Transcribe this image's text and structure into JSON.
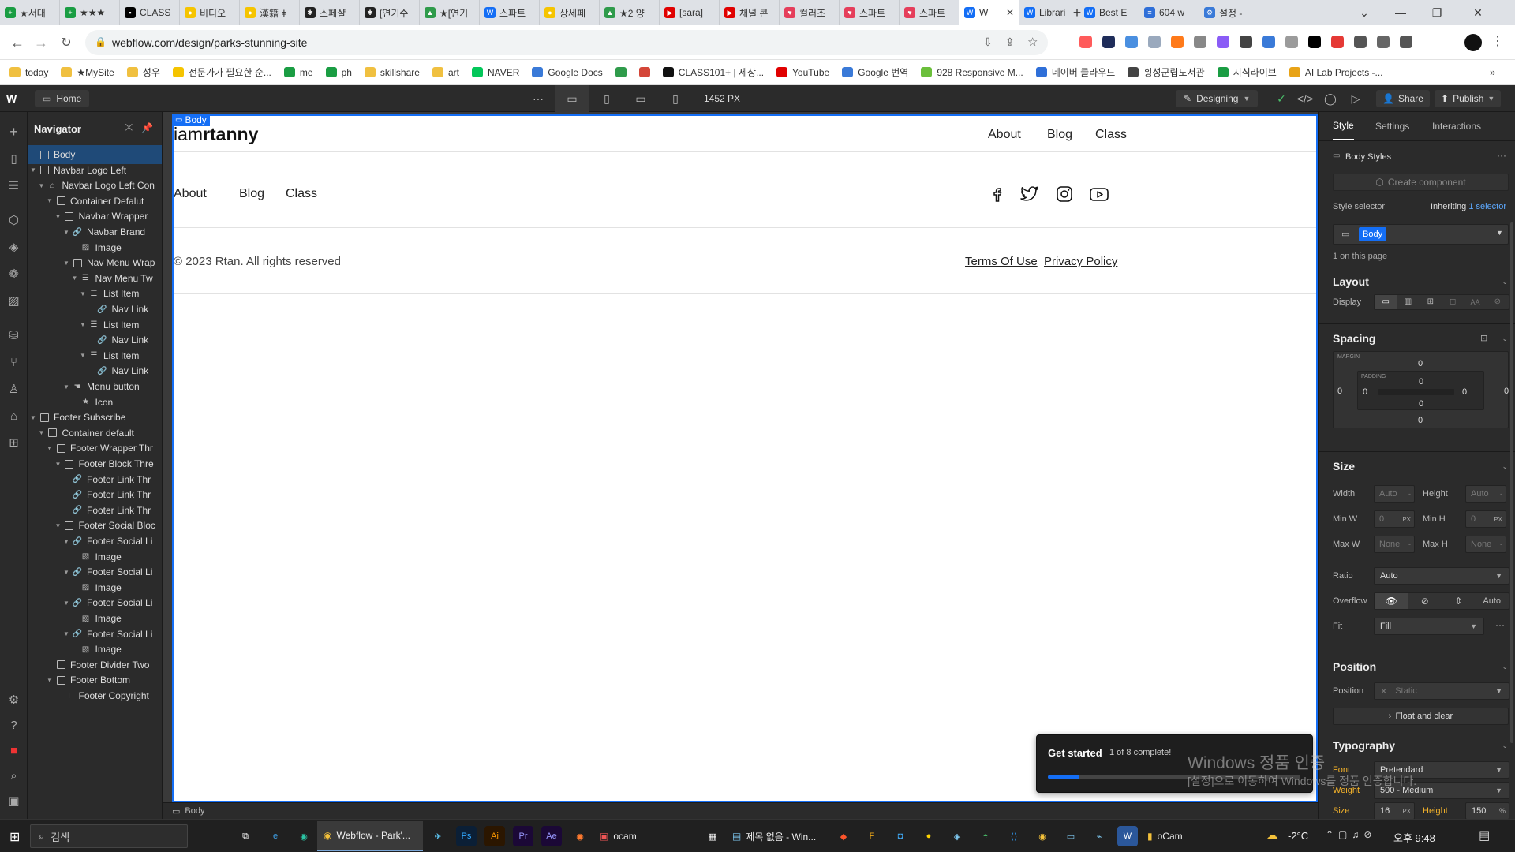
{
  "browser": {
    "tabs": [
      {
        "label": "★서대",
        "fav": "#1a9d43",
        "glyph": "+"
      },
      {
        "label": "★★★",
        "fav": "#1a9d43",
        "glyph": "+"
      },
      {
        "label": "CLASS",
        "fav": "#000000",
        "glyph": "▪"
      },
      {
        "label": "비디오",
        "fav": "#f5c400",
        "glyph": "●"
      },
      {
        "label": "漢籍 ǂ",
        "fav": "#f5c400",
        "glyph": "●"
      },
      {
        "label": "스페샬",
        "fav": "#222222",
        "glyph": "✱"
      },
      {
        "label": "[연기수",
        "fav": "#222222",
        "glyph": "✱"
      },
      {
        "label": "★[연기",
        "fav": "#2f9b4b",
        "glyph": "▲"
      },
      {
        "label": "스파트",
        "fav": "#146ef5",
        "glyph": "W"
      },
      {
        "label": "상세페",
        "fav": "#f5c400",
        "glyph": "●"
      },
      {
        "label": "★2 양",
        "fav": "#2f9b4b",
        "glyph": "▲"
      },
      {
        "label": "[sara]",
        "fav": "#e00000",
        "glyph": "▶"
      },
      {
        "label": "채널 콘",
        "fav": "#e00000",
        "glyph": "▶"
      },
      {
        "label": "컬러조",
        "fav": "#e53e5b",
        "glyph": "♥"
      },
      {
        "label": "스파트",
        "fav": "#e53e5b",
        "glyph": "♥"
      },
      {
        "label": "스파트",
        "fav": "#e53e5b",
        "glyph": "♥"
      },
      {
        "label": "W",
        "fav": "#146ef5",
        "glyph": "W",
        "active": true
      },
      {
        "label": "Librari",
        "fav": "#146ef5",
        "glyph": "W"
      },
      {
        "label": "Best E",
        "fav": "#146ef5",
        "glyph": "W"
      },
      {
        "label": "604 w",
        "fav": "#2f6fd8",
        "glyph": "≡"
      },
      {
        "label": "설정 -",
        "fav": "#3a7ad8",
        "glyph": "⚙"
      }
    ],
    "url": "webflow.com/design/parks-stunning-site",
    "bookmarks": [
      {
        "label": "today",
        "fav": "#f0c040"
      },
      {
        "label": "★MySite",
        "fav": "#f0c040"
      },
      {
        "label": "성우",
        "fav": "#f0c040"
      },
      {
        "label": "전문가가 필요한 순...",
        "fav": "#f5c400"
      },
      {
        "label": "me",
        "fav": "#1a9d43"
      },
      {
        "label": "ph",
        "fav": "#1a9d43"
      },
      {
        "label": "skillshare",
        "fav": "#f0c040"
      },
      {
        "label": "art",
        "fav": "#f0c040"
      },
      {
        "label": "NAVER",
        "fav": "#03c75a"
      },
      {
        "label": "Google Docs",
        "fav": "#3a7ad8"
      },
      {
        "label": "",
        "fav": "#2f9b4b"
      },
      {
        "label": "",
        "fav": "#d44638"
      },
      {
        "label": "CLASS101+ | 세상...",
        "fav": "#111111"
      },
      {
        "label": "YouTube",
        "fav": "#e00000"
      },
      {
        "label": "Google 번역",
        "fav": "#3a7ad8"
      },
      {
        "label": "928 Responsive M...",
        "fav": "#6bbf3b"
      },
      {
        "label": "네이버 클라우드",
        "fav": "#2f6fd8"
      },
      {
        "label": "횡성군립도서관",
        "fav": "#444444"
      },
      {
        "label": "지식라이브",
        "fav": "#1a9d43"
      },
      {
        "label": "AI Lab Projects -...",
        "fav": "#e8a317"
      }
    ]
  },
  "wf": {
    "page_name": "Home",
    "breakpoint_width": "1452 PX",
    "mode": "Designing",
    "share_label": "Share",
    "publish_label": "Publish",
    "navigator": {
      "title": "Navigator",
      "items": [
        {
          "label": "Body",
          "depth": 0,
          "icon": "box",
          "caret": false,
          "sel": true
        },
        {
          "label": "Navbar Logo Left",
          "depth": 0,
          "icon": "box",
          "caret": true
        },
        {
          "label": "Navbar Logo Left Con",
          "depth": 1,
          "icon": "comp",
          "caret": true
        },
        {
          "label": "Container Defalut",
          "depth": 2,
          "icon": "box",
          "caret": true
        },
        {
          "label": "Navbar Wrapper",
          "depth": 3,
          "icon": "box",
          "caret": true
        },
        {
          "label": "Navbar Brand",
          "depth": 4,
          "icon": "link",
          "caret": true
        },
        {
          "label": "Image",
          "depth": 5,
          "icon": "img",
          "caret": false
        },
        {
          "label": "Nav Menu Wrap",
          "depth": 4,
          "icon": "box",
          "caret": true
        },
        {
          "label": "Nav Menu Tw",
          "depth": 5,
          "icon": "list",
          "caret": true
        },
        {
          "label": "List Item",
          "depth": 6,
          "icon": "list",
          "caret": true
        },
        {
          "label": "Nav Link",
          "depth": 7,
          "icon": "link",
          "caret": false
        },
        {
          "label": "List Item",
          "depth": 6,
          "icon": "list",
          "caret": true
        },
        {
          "label": "Nav Link",
          "depth": 7,
          "icon": "link",
          "caret": false
        },
        {
          "label": "List Item",
          "depth": 6,
          "icon": "list",
          "caret": true
        },
        {
          "label": "Nav Link",
          "depth": 7,
          "icon": "link",
          "caret": false
        },
        {
          "label": "Menu button",
          "depth": 4,
          "icon": "hand",
          "caret": true
        },
        {
          "label": "Icon",
          "depth": 5,
          "icon": "star",
          "caret": false
        },
        {
          "label": "Footer Subscribe",
          "depth": 0,
          "icon": "box",
          "caret": true
        },
        {
          "label": "Container default",
          "depth": 1,
          "icon": "box",
          "caret": true
        },
        {
          "label": "Footer Wrapper Thr",
          "depth": 2,
          "icon": "box",
          "caret": true
        },
        {
          "label": "Footer Block Thre",
          "depth": 3,
          "icon": "box",
          "caret": true
        },
        {
          "label": "Footer Link Thr",
          "depth": 4,
          "icon": "link",
          "caret": false
        },
        {
          "label": "Footer Link Thr",
          "depth": 4,
          "icon": "link",
          "caret": false
        },
        {
          "label": "Footer Link Thr",
          "depth": 4,
          "icon": "link",
          "caret": false
        },
        {
          "label": "Footer Social Bloc",
          "depth": 3,
          "icon": "box",
          "caret": true
        },
        {
          "label": "Footer Social Li",
          "depth": 4,
          "icon": "link",
          "caret": true
        },
        {
          "label": "Image",
          "depth": 5,
          "icon": "img",
          "caret": false
        },
        {
          "label": "Footer Social Li",
          "depth": 4,
          "icon": "link",
          "caret": true
        },
        {
          "label": "Image",
          "depth": 5,
          "icon": "img",
          "caret": false
        },
        {
          "label": "Footer Social Li",
          "depth": 4,
          "icon": "link",
          "caret": true
        },
        {
          "label": "Image",
          "depth": 5,
          "icon": "img",
          "caret": false
        },
        {
          "label": "Footer Social Li",
          "depth": 4,
          "icon": "link",
          "caret": true
        },
        {
          "label": "Image",
          "depth": 5,
          "icon": "img",
          "caret": false
        },
        {
          "label": "Footer Divider Two",
          "depth": 2,
          "icon": "box",
          "caret": false
        },
        {
          "label": "Footer Bottom",
          "depth": 2,
          "icon": "box",
          "caret": true
        },
        {
          "label": "Footer Copyright",
          "depth": 3,
          "icon": "text",
          "caret": false
        }
      ]
    },
    "canvas": {
      "body_tag": "Body",
      "brand_light": "iam",
      "brand_bold": "rtanny",
      "header_links": [
        "About",
        "Blog",
        "Class"
      ],
      "footer_links": [
        "About",
        "Blog",
        "Class"
      ],
      "copyright": "© 2023 Rtan. All rights reserved",
      "legal_links": [
        "Terms Of Use",
        "Privacy Policy"
      ],
      "social_icons": [
        "facebook-icon",
        "twitter-icon",
        "instagram-icon",
        "youtube-icon"
      ]
    },
    "breadcrumb": "Body",
    "get_started": {
      "title": "Get started",
      "progress_text": "1 of 8 complete!",
      "progress": 0.125
    },
    "watermark": {
      "line1": "Windows 정품 인증",
      "line2": "[설정]으로 이동하여 Windows를 정품 인증합니다."
    },
    "style_panel": {
      "tabs": [
        "Style",
        "Settings",
        "Interactions"
      ],
      "body_styles": "Body Styles",
      "create_component": "Create component",
      "style_selector_label": "Style selector",
      "inheriting": "Inheriting",
      "inheriting_count": "1 selector",
      "selector_chip": "Body",
      "on_page": "1 on this page",
      "layout": {
        "title": "Layout",
        "display_label": "Display"
      },
      "spacing": {
        "title": "Spacing",
        "margin_label": "MARGIN",
        "padding_label": "PADDING",
        "margin": [
          "0",
          "0",
          "0",
          "0"
        ],
        "padding": [
          "0",
          "0",
          "0",
          "0"
        ]
      },
      "size": {
        "title": "Size",
        "width_label": "Width",
        "width": "Auto",
        "height_label": "Height",
        "height": "Auto",
        "minw_label": "Min W",
        "minw": "0",
        "minh_label": "Min H",
        "minh": "0",
        "px": "PX",
        "maxw_label": "Max W",
        "maxw": "None",
        "maxh_label": "Max H",
        "maxh": "None",
        "ratio_label": "Ratio",
        "ratio": "Auto",
        "overflow_label": "Overflow",
        "overflow_auto": "Auto",
        "fit_label": "Fit",
        "fit": "Fill"
      },
      "position": {
        "title": "Position",
        "label": "Position",
        "value": "Static",
        "float_clear": "Float and clear"
      },
      "typography": {
        "title": "Typography",
        "font_label": "Font",
        "font": "Pretendard",
        "weight_label": "Weight",
        "weight": "500 - Medium",
        "size_label": "Size",
        "size": "16",
        "height_label": "Height",
        "height": "150"
      }
    }
  },
  "taskbar": {
    "search": "검색",
    "apps": [
      {
        "label": "Webflow - Park'...",
        "active": true
      },
      {
        "label": "ocam"
      },
      {
        "label": "제목 없음 - Win..."
      },
      {
        "label": "oCam"
      }
    ],
    "weather": "-2°C",
    "time": "오후 9:48"
  }
}
